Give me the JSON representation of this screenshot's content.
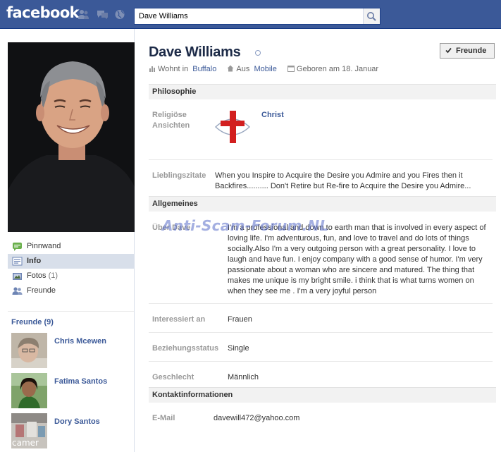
{
  "topbar": {
    "logo": "facebook",
    "search_value": "Dave Williams",
    "icons": [
      "friends-requests-icon",
      "messages-icon",
      "notifications-globe-icon",
      "search-icon"
    ]
  },
  "sidebar": {
    "nav": [
      {
        "label": "Pinnwand",
        "icon": "wall-icon"
      },
      {
        "label": "Info",
        "icon": "info-icon"
      },
      {
        "label": "Fotos",
        "count": "(1)",
        "icon": "photos-icon"
      },
      {
        "label": "Freunde",
        "icon": "friends-icon"
      }
    ],
    "friends_header": "Freunde (9)",
    "friends": [
      {
        "name": "Chris Mcewen"
      },
      {
        "name": "Fatima Santos"
      },
      {
        "name": "Dory Santos",
        "photo_text": "camer"
      }
    ]
  },
  "profile": {
    "name": "Dave Williams",
    "friend_button": "Freunde",
    "lives_prefix": "Wohnt in",
    "lives_city": "Buffalo",
    "from_prefix": "Aus",
    "from_city": "Mobile",
    "birthday": "Geboren am 18. Januar"
  },
  "philosophy": {
    "header": "Philosophie",
    "religion_label": "Religiöse Ansichten",
    "religion_value": "Christ",
    "quotes_label": "Lieblingszitate",
    "quotes_value": "When you Inspire to Acquire the Desire you Admire and you Fires then it Backfires.......... Don't Retire but Re-fire to Acquire the Desire you Admire..."
  },
  "general": {
    "header": "Allgemeines",
    "about_label": "Über Dave",
    "about_value": "I'm a professional and down to earth man that is involved in every aspect of loving life. I'm adventurous, fun, and love to travel and do lots of things socially.Also I'm a very outgoing person with a great personality. I love to laugh and have fun. I enjoy company with a good sense of humor. I'm very passionate about a woman who are sincere and matured. The thing that makes me unique is my bright smile. i think that is what turns women on when they see me . I'm a very joyful person",
    "interested_label": "Interessiert an",
    "interested_value": "Frauen",
    "relationship_label": "Beziehungsstatus",
    "relationship_value": "Single",
    "gender_label": "Geschlecht",
    "gender_value": "Männlich"
  },
  "contact": {
    "header": "Kontaktinformationen",
    "email_label": "E-Mail",
    "email_value": "davewill472@yahoo.com"
  },
  "watermark": "Anti-Scam-Forum.NL",
  "colors": {
    "brand": "#3b5998",
    "name": "#1c2a47",
    "label_gray": "#999999",
    "active_nav": "#d8dfea"
  }
}
